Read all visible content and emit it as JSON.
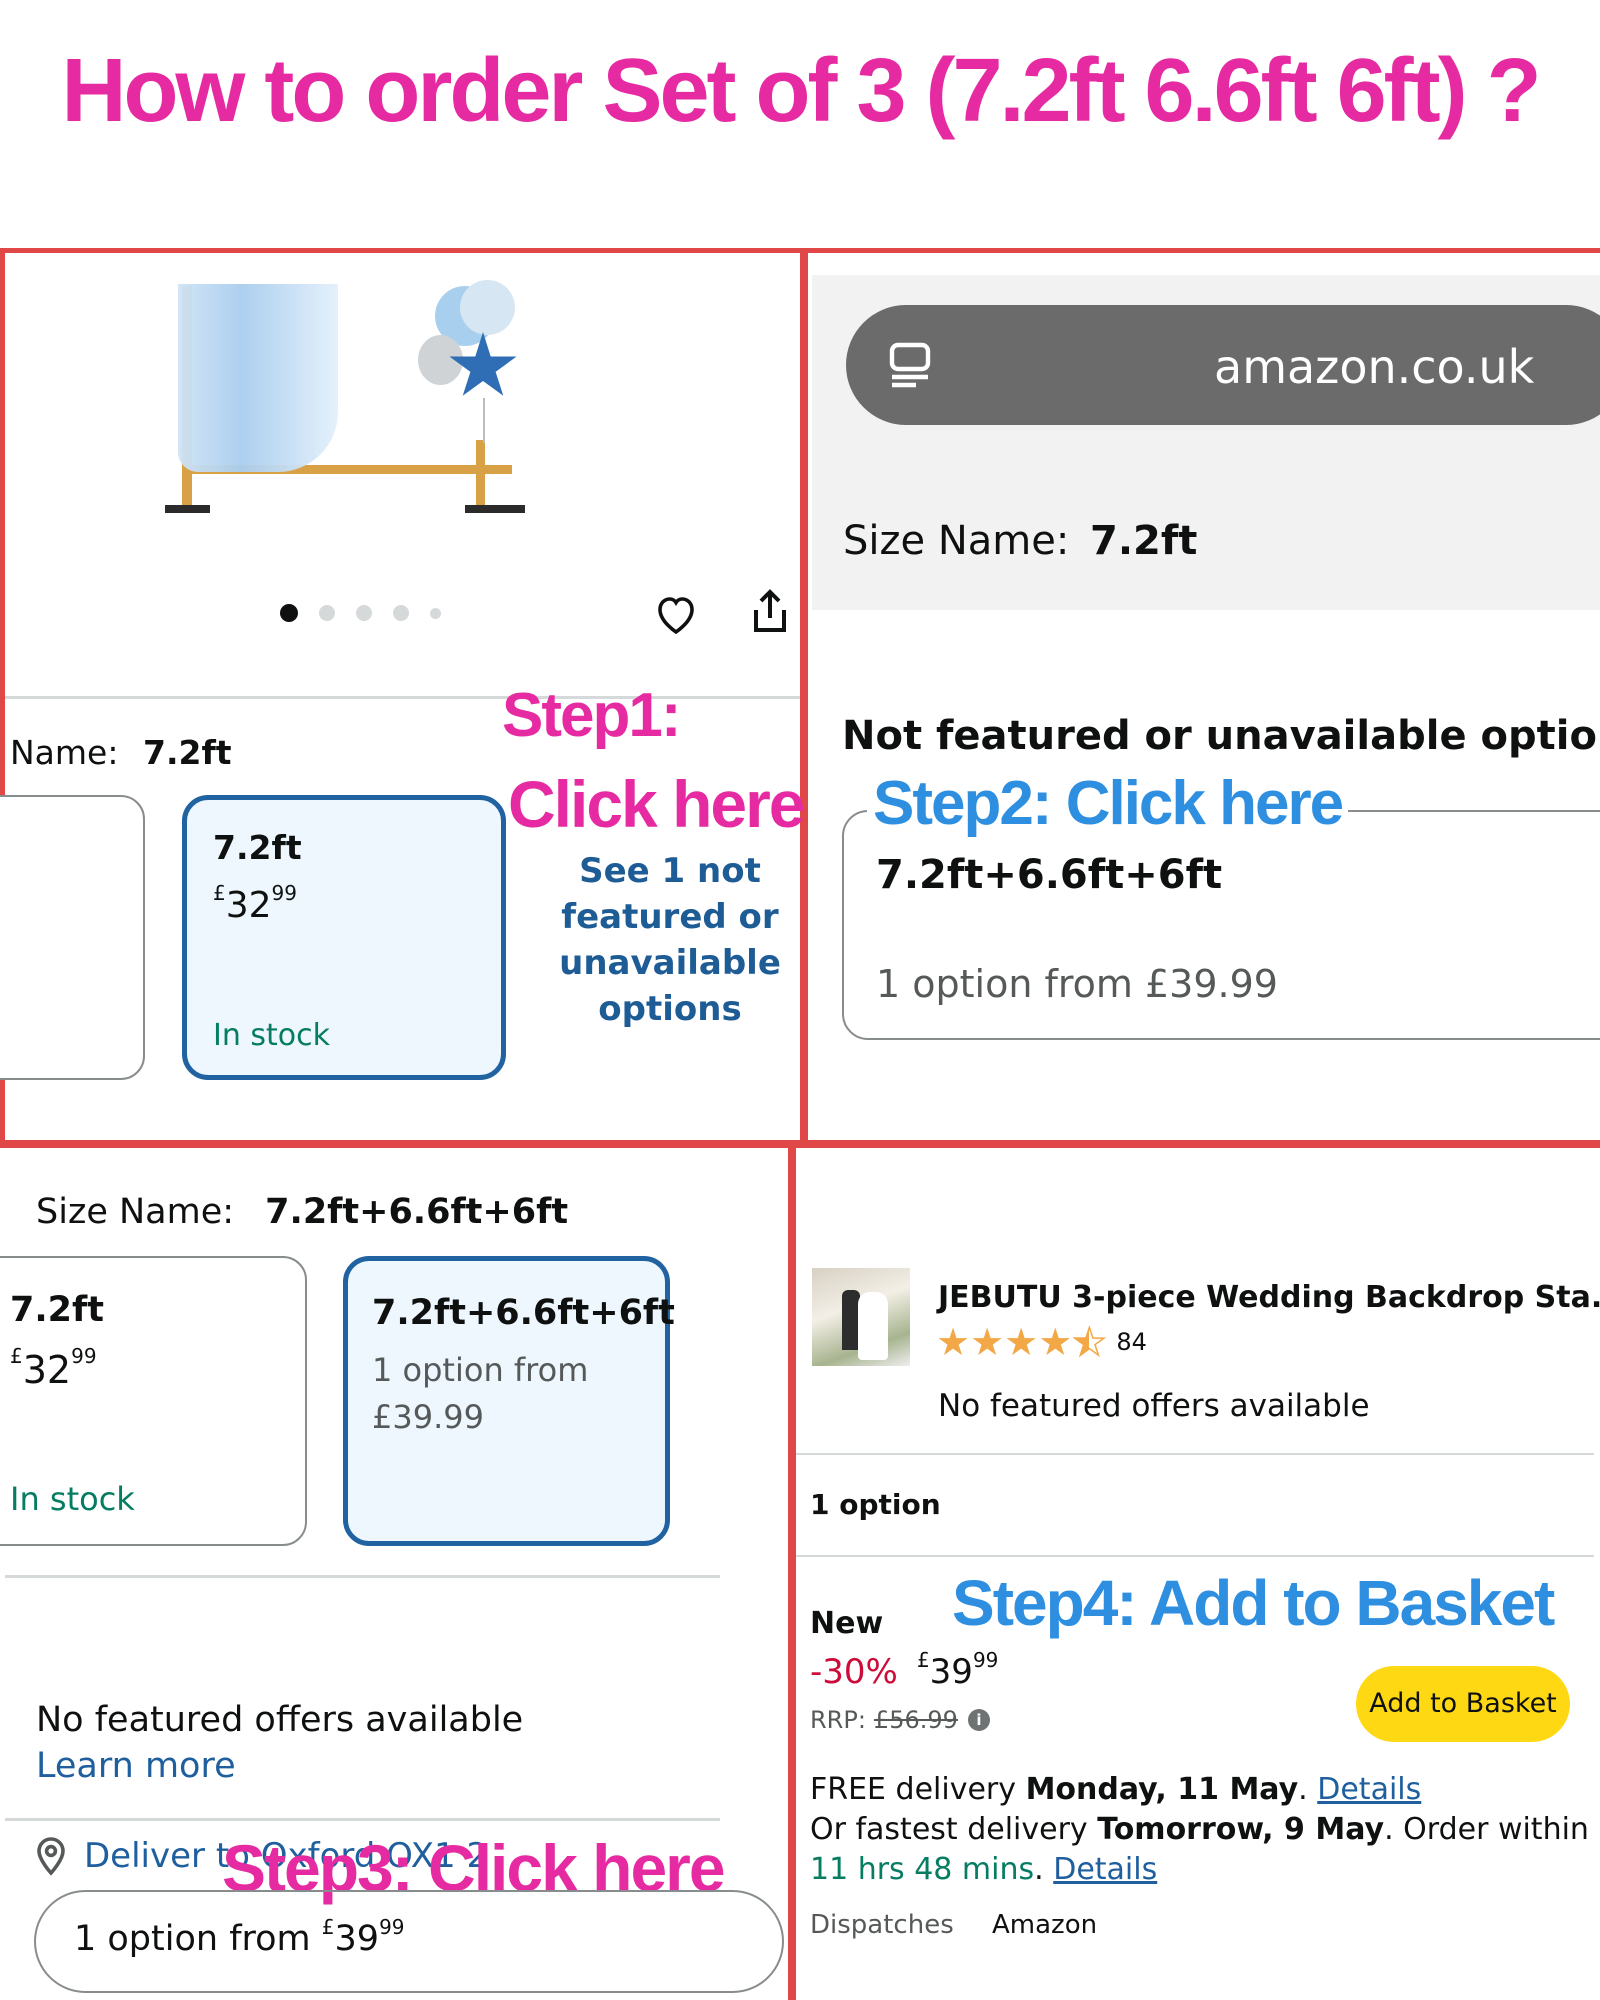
{
  "title": "How to order Set of 3 (7.2ft 6.6ft 6ft) ?",
  "panel1": {
    "size_label": "Name:",
    "size_value": "7.2ft",
    "card": {
      "size": "7.2ft",
      "price_symbol": "£",
      "price_whole": "32",
      "price_fraction": "99",
      "stock": "In stock"
    },
    "step_line1": "Step1:",
    "step_line2": "Click here",
    "see_more": [
      "See 1 not",
      "featured or",
      "unavailable",
      "options"
    ],
    "carousel_dots": 5
  },
  "panel2": {
    "url": "amazon.co.uk",
    "size_label": "Size Name:",
    "size_value": "7.2ft",
    "section_title": "Not featured or unavailable options",
    "step": "Step2: Click here",
    "option_name": "7.2ft+6.6ft+6ft",
    "option_price": "1 option from £39.99"
  },
  "panel3": {
    "size_label": "Size Name:",
    "size_value": "7.2ft+6.6ft+6ft",
    "card1": {
      "size": "7.2ft",
      "price_symbol": "£",
      "price_whole": "32",
      "price_fraction": "99",
      "stock": "In stock"
    },
    "card2": {
      "size": "7.2ft+6.6ft+6ft",
      "line1": "1 option from",
      "line2": "£39.99"
    },
    "no_offers": "No featured offers available",
    "learn_more": "Learn more",
    "deliver": "Deliver to Oxford OX1 2",
    "step": "Step3: Click here",
    "option_btn_text": "1 option from ",
    "option_btn_symbol": "£",
    "option_btn_whole": "39",
    "option_btn_fraction": "99"
  },
  "panel4": {
    "product_title": "JEBUTU 3-piece Wedding Backdrop Sta...",
    "rating": 4.5,
    "rating_count": "84",
    "no_offers": "No featured offers available",
    "options_count": "1 option",
    "condition": "New",
    "step": "Step4: Add to Basket",
    "discount": "-30%",
    "price_symbol": "£",
    "price_whole": "39",
    "price_fraction": "99",
    "rrp_label": "RRP:",
    "rrp_value": "£56.99",
    "add_button": "Add to Basket",
    "delivery_free": "FREE delivery ",
    "delivery_free_date": "Monday, 11 May",
    "delivery_details": "Details",
    "fastest_prefix": "Or fastest delivery ",
    "fastest_date": "Tomorrow, 9 May",
    "order_within": ". Order within",
    "countdown": "11 hrs 48 mins",
    "dispatches_label": "Dispatches",
    "dispatches_value": "Amazon"
  },
  "colors": {
    "accent_magenta": "#e62ba2",
    "step_blue": "#2e8fe0",
    "selected_border": "#2162a1",
    "panel_border": "#e04848",
    "button_yellow": "#ffd814",
    "in_stock_green": "#067d62"
  }
}
